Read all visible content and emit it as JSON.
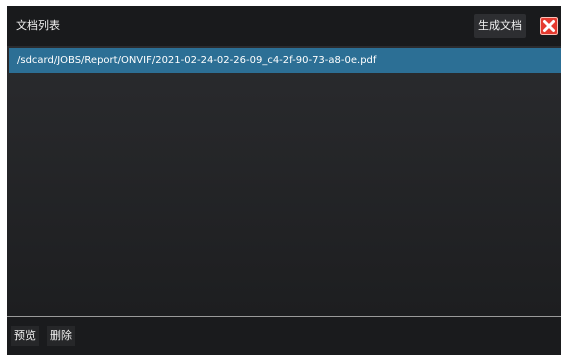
{
  "window": {
    "title": "文档列表",
    "generate_label": "生成文档",
    "close_icon": "close-x-icon"
  },
  "documents": [
    {
      "path": "/sdcard/JOBS/Report/ONVIF/2021-02-24-02-26-09_c4-2f-90-73-a8-0e.pdf",
      "selected": true
    }
  ],
  "footer": {
    "preview_label": "预览",
    "delete_label": "删除"
  },
  "colors": {
    "selection": "#2c6f95",
    "close_icon_bg": "#e53a2f",
    "background": "#1f2022"
  }
}
